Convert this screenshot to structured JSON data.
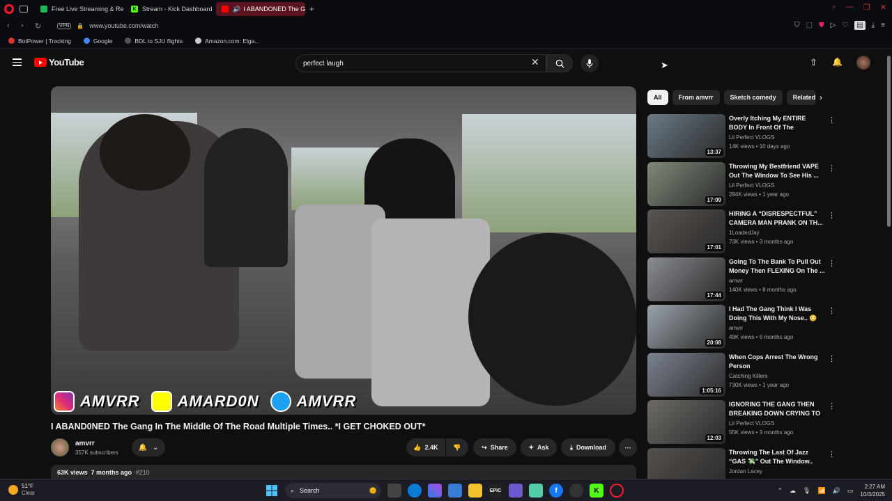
{
  "browser": {
    "tabs": [
      {
        "label": "Free Live Streaming & Re",
        "icon": "twitch-icon",
        "color": "#1db954",
        "active": false
      },
      {
        "label": "Stream - Kick Dashboard",
        "icon": "kick-icon",
        "color": "#53fc18",
        "active": false
      },
      {
        "label": "I ABANDONED The Ga",
        "icon": "youtube-icon",
        "color": "#ff0000",
        "active": true
      }
    ],
    "url": "www.youtube.com/watch",
    "vpn_label": "VPN",
    "bookmarks": [
      {
        "label": "BotPower | Tracking",
        "color": "#d33"
      },
      {
        "label": "Google",
        "color": "#4285f4"
      },
      {
        "label": "BDL to SJU flights",
        "color": "#999"
      },
      {
        "label": "Amazon.com: Elga...",
        "color": "#ccc"
      }
    ]
  },
  "header": {
    "logo_text": "YouTube",
    "search_value": "perfect laugh"
  },
  "video": {
    "overlay": {
      "instagram": "AMVRR",
      "snapchat": "AMARD0N",
      "twitter": "AMVRR"
    },
    "title": "I ABAND0NED The Gang In The Middle Of The Road Multiple Times.. *I GET CHOKED OUT*",
    "channel": "amvrr",
    "subscribers": "357K subscribers",
    "likes": "2.4K",
    "share_label": "Share",
    "ask_label": "Ask",
    "download_label": "Download",
    "views": "63K views",
    "age": "7 months ago",
    "hashtag": "#210"
  },
  "chips": [
    "All",
    "From amvrr",
    "Sketch comedy",
    "Related"
  ],
  "recommendations": [
    {
      "title": "Overly Itching My ENTIRE BODY In Front Of The Gang..*BAD ...",
      "channel": "Lil Perfect VLOGS",
      "meta": "14K views • 10 days ago",
      "duration": "13:37",
      "color": "#6b7a86"
    },
    {
      "title": "Throwing My Bestfriend VAPE Out The Window To See His ...",
      "channel": "Lil Perfect VLOGS",
      "meta": "284K views • 1 year ago",
      "duration": "17:09",
      "color": "#7f8a7a"
    },
    {
      "title": "HIRING A “DISRESPECTFUL” CAMERA MAN PRANK ON TH...",
      "channel": "1LoadedJay",
      "meta": "73K views • 3 months ago",
      "duration": "17:01",
      "color": "#5b5450"
    },
    {
      "title": "Going To The Bank To Pull Out Money Then FLEXING On The ...",
      "channel": "amvrr",
      "meta": "140K views • 8 months ago",
      "duration": "17:44",
      "color": "#8a8d92"
    },
    {
      "title": "I Had The Gang Think I Was Doing This With My Nose.. 😳",
      "channel": "amvrr",
      "meta": "49K views • 6 months ago",
      "duration": "20:08",
      "color": "#9aa3ab"
    },
    {
      "title": "When Cops Arrest The Wrong Person",
      "channel": "Catching Killers",
      "meta": "730K views • 1 year ago",
      "duration": "1:05:16",
      "color": "#7b8290"
    },
    {
      "title": "IGNORING THE GANG THEN BREAKING DOWN CRYING TO ...",
      "channel": "Lil Perfect VLOGS",
      "meta": "55K views • 3 months ago",
      "duration": "12:03",
      "color": "#6d6a66"
    },
    {
      "title": "Throwing The Last Of Jazz “GAS 💸” Out The Window..",
      "channel": "Jordan Lacey",
      "meta": "",
      "duration": "",
      "color": "#55504c"
    }
  ],
  "taskbar": {
    "temp": "51°F",
    "condition": "Clear",
    "search_label": "Search",
    "time": "2:27 AM",
    "date": "10/3/2025"
  }
}
